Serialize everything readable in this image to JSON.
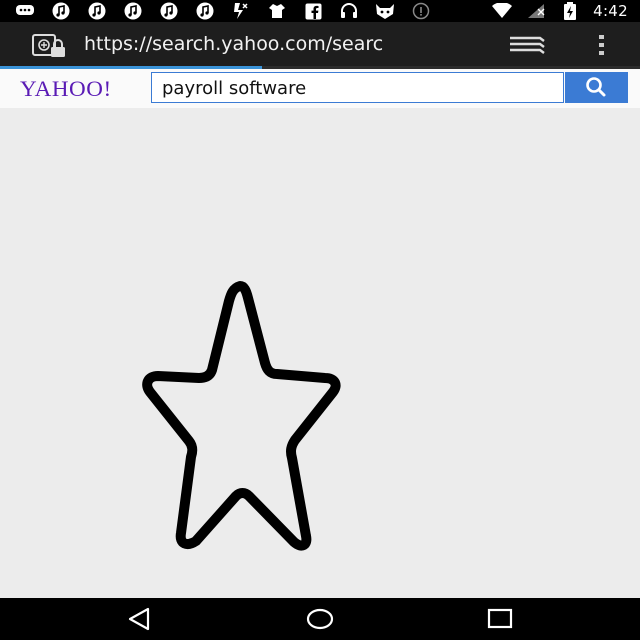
{
  "status_bar": {
    "time": "4:42",
    "left_icons": [
      "chat-icon",
      "music-icon",
      "music-icon",
      "music-icon",
      "music-icon",
      "music-icon",
      "flash-icon",
      "shirt-icon",
      "facebook-icon",
      "headset-icon",
      "cat-icon",
      "info-icon"
    ],
    "right_icons": [
      "wifi-icon",
      "signal-icon",
      "battery-charging-icon"
    ]
  },
  "browser": {
    "url": "https://search.yahoo.com/searc",
    "icons": [
      "secure-page-icon",
      "tabs-icon",
      "overflow-menu-icon"
    ]
  },
  "yahoo": {
    "logo_text": "YAHOO!",
    "search_value": "payroll software",
    "search_icon": "search-icon"
  },
  "nav_bar": {
    "icons": [
      "back-icon",
      "home-icon",
      "recents-icon"
    ]
  },
  "colors": {
    "yahoo_purple": "#5a1bb5",
    "search_blue": "#3b7bd4",
    "progress_blue": "#3a93d8",
    "toolbar_bg": "#1e1e1e",
    "content_bg": "#ececec"
  }
}
